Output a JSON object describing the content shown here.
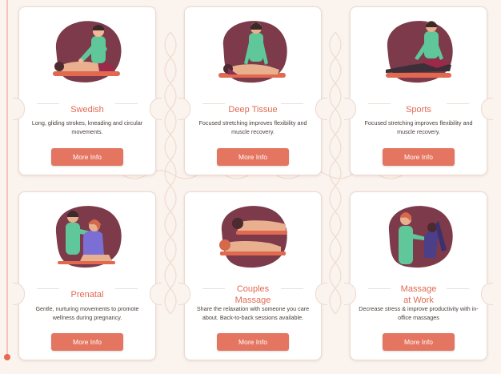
{
  "colors": {
    "accent": "#e47560",
    "title": "#e06a52",
    "bg": "#fbf3ee",
    "blob": "#7c3a4a",
    "uniform": "#5fc79a"
  },
  "cards": [
    {
      "title": "Swedish",
      "desc": "Long, gliding strokes, kneading and circular movements.",
      "button": "More Info",
      "icon": "swedish-massage-illustration"
    },
    {
      "title": "Deep Tissue",
      "desc": "Focused stretching improves flexibility and muscle recovery.",
      "button": "More Info",
      "icon": "deep-tissue-massage-illustration"
    },
    {
      "title": "Sports",
      "desc": "Focused stretching improves flexibility and muscle recovery.",
      "button": "More Info",
      "icon": "sports-massage-illustration"
    },
    {
      "title": "Prenatal",
      "desc": "Gentle, nurturing movements to promote wellness during pregnancy.",
      "button": "More Info",
      "icon": "prenatal-massage-illustration"
    },
    {
      "title": "Couples\nMassage",
      "desc": "Share the relaxation with someone you care about. Back-to-back sessions available.",
      "button": "More Info",
      "icon": "couples-massage-illustration"
    },
    {
      "title": "Massage\nat Work",
      "desc": "Decrease stress & improve productivity with in-office massages",
      "button": "More Info",
      "icon": "massage-at-work-illustration"
    }
  ]
}
